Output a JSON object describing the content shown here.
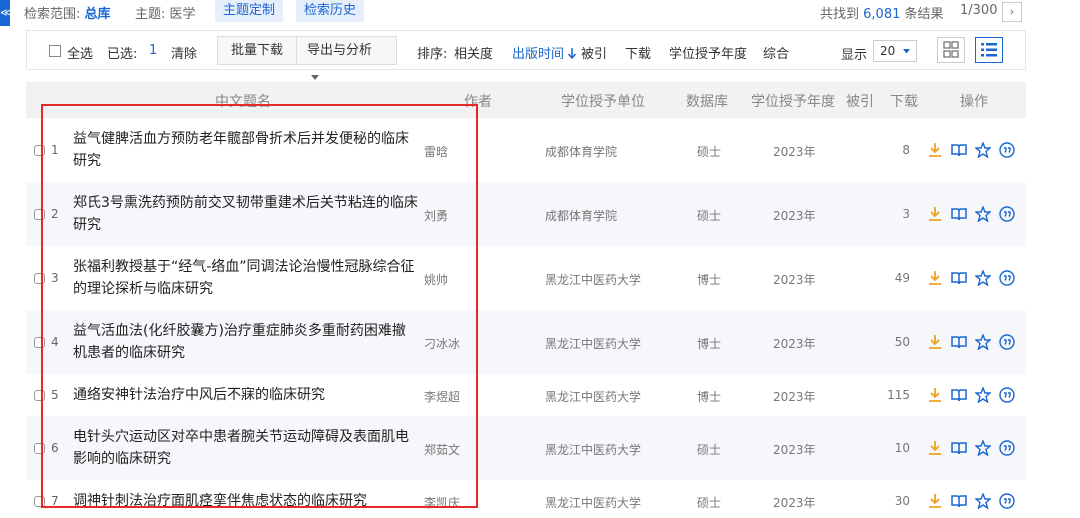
{
  "edge_tab": {
    "glyph": "≪"
  },
  "search_bar": {
    "scope_label": "检索范围:",
    "scope_value": "总库",
    "topic_label": "主题:",
    "topic_value": "医学",
    "custom_topic": "主题定制",
    "history": "检索历史",
    "found_prefix": "共找到",
    "found_count": "6,081",
    "found_suffix": "条结果",
    "page_indicator": "1/300",
    "next_glyph": "›"
  },
  "toolbar": {
    "select_all": "全选",
    "selected_label": "已选:",
    "selected_count": "1",
    "clear": "清除",
    "batch_download": "批量下载",
    "export_analyze": "导出与分析",
    "sort_label": "排序:",
    "sort_relevance": "相关度",
    "sort_pub_time": "出版时间",
    "sort_cited": "被引",
    "sort_download": "下载",
    "sort_degree_year": "学位授予年度",
    "sort_overall": "综合",
    "display_label": "显示",
    "page_size": "20",
    "accent": "#1a66d2"
  },
  "table": {
    "headers": {
      "title": "中文题名",
      "author": "作者",
      "unit": "学位授予单位",
      "db": "数据库",
      "year": "学位授予年度",
      "cited": "被引",
      "download": "下载",
      "ops": "操作"
    },
    "rows": [
      {
        "num": "1",
        "title": "益气健脾活血方预防老年髋部骨折术后并发便秘的临床研究",
        "author": "雷晗",
        "unit": "成都体育学院",
        "db": "硕士",
        "year": "2023年",
        "download": "8"
      },
      {
        "num": "2",
        "title": "郑氏3号熏洗药预防前交叉韧带重建术后关节粘连的临床研究",
        "author": "刘勇",
        "unit": "成都体育学院",
        "db": "硕士",
        "year": "2023年",
        "download": "3"
      },
      {
        "num": "3",
        "title": "张福利教授基于“经气-络血”同调法论治慢性冠脉综合征的理论探析与临床研究",
        "author": "姚帅",
        "unit": "黑龙江中医药大学",
        "db": "博士",
        "year": "2023年",
        "download": "49"
      },
      {
        "num": "4",
        "title": "益气活血法(化纤胶囊方)治疗重症肺炎多重耐药困难撤机患者的临床研究",
        "author": "刁冰冰",
        "unit": "黑龙江中医药大学",
        "db": "博士",
        "year": "2023年",
        "download": "50"
      },
      {
        "num": "5",
        "title": "通络安神针法治疗中风后不寐的临床研究",
        "author": "李煜超",
        "unit": "黑龙江中医药大学",
        "db": "博士",
        "year": "2023年",
        "download": "115"
      },
      {
        "num": "6",
        "title": "电针头穴运动区对卒中患者腕关节运动障碍及表面肌电影响的临床研究",
        "author": "郑茹文",
        "unit": "黑龙江中医药大学",
        "db": "硕士",
        "year": "2023年",
        "download": "10"
      },
      {
        "num": "7",
        "title": "调神针刺法治疗面肌痉挛伴焦虑状态的临床研究",
        "author": "李凯庆",
        "unit": "黑龙江中医药大学",
        "db": "硕士",
        "year": "2023年",
        "download": "30"
      }
    ],
    "op_icons": [
      "download-icon",
      "read-book-icon",
      "favorite-star-icon",
      "cite-quote-icon"
    ],
    "op_colors": {
      "download": "#f0a020",
      "other": "#1a66d2"
    }
  },
  "highlight_color": "#e62a2a"
}
